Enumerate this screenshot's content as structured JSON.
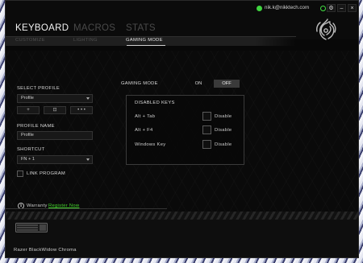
{
  "header": {
    "tabs": [
      {
        "label": "KEYBOARD",
        "active": true
      },
      {
        "label": "MACROS",
        "active": false
      },
      {
        "label": "STATS",
        "active": false
      }
    ],
    "subtabs": [
      {
        "label": "CUSTOMIZE",
        "active": false
      },
      {
        "label": "LIGHTING",
        "active": false
      },
      {
        "label": "GAMING MODE",
        "active": true
      }
    ],
    "user_email": "nik.k@nikktech.com",
    "user_separator": "~",
    "window_buttons": [
      "⚙",
      "–",
      "×"
    ]
  },
  "profile": {
    "section_label": "SELECT PROFILE",
    "selected": "Profile",
    "buttons": [
      "+",
      "⊡",
      "• • •"
    ],
    "name_label": "PROFILE NAME",
    "name_value": "Profile",
    "shortcut_label": "SHORTCUT",
    "shortcut_value": "FN + 1",
    "link_program_label": "LINK PROGRAM"
  },
  "gaming_mode": {
    "label": "GAMING MODE",
    "on_label": "ON",
    "off_label": "OFF",
    "state": "OFF"
  },
  "disabled_keys": {
    "title": "DISABLED KEYS",
    "items": [
      {
        "key": "Alt + Tab",
        "action": "Disable",
        "checked": false
      },
      {
        "key": "Alt + F4",
        "action": "Disable",
        "checked": false
      },
      {
        "key": "Windows Key",
        "action": "Disable",
        "checked": false
      }
    ]
  },
  "warranty": {
    "label": "Warranty",
    "link": "Register Now"
  },
  "device": {
    "name": "Razer BlackWidow Chroma"
  },
  "colors": {
    "accent_green": "#44d62c",
    "background": "#080808",
    "text_active": "#f2f2f2",
    "text_inactive": "#4a4a4a"
  }
}
